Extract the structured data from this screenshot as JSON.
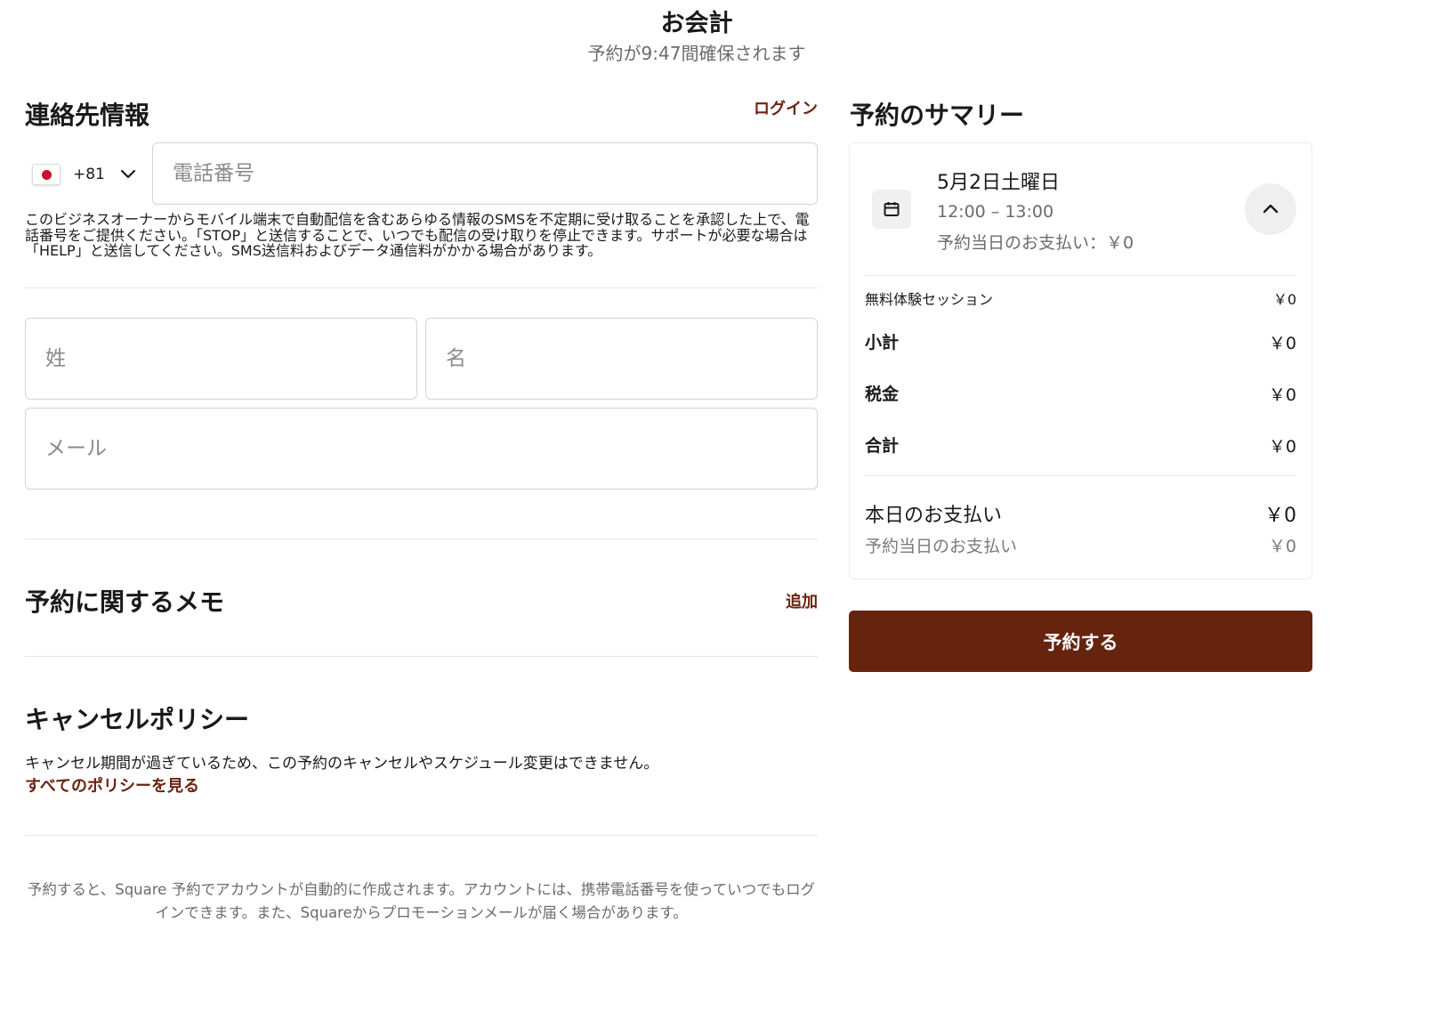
{
  "header": {
    "title": "お会計",
    "subtitle": "予約が9:47間確保されます"
  },
  "contact": {
    "title": "連絡先情報",
    "login_link": "ログイン",
    "country_code": "+81",
    "phone_placeholder": "電話番号",
    "consent_text": "このビジネスオーナーからモバイル端末で自動配信を含むあらゆる情報のSMSを不定期に受け取ることを承認した上で、電話番号をご提供ください。「STOP」と送信することで、いつでも配信の受け取りを停止できます。サポートが必要な場合は「HELP」と送信してください。SMS送信料およびデータ通信料がかかる場合があります。",
    "last_name_placeholder": "姓",
    "first_name_placeholder": "名",
    "email_placeholder": "メール"
  },
  "memo": {
    "title": "予約に関するメモ",
    "add_link": "追加"
  },
  "cancel_policy": {
    "title": "キャンセルポリシー",
    "text": "キャンセル期間が過ぎているため、この予約のキャンセルやスケジュール変更はできません。",
    "link": "すべてのポリシーを見る"
  },
  "footer_note": "予約すると、Square 予約でアカウントが自動的に作成されます。アカウントには、携帯電話番号を使っていつでもログインできます。また、Squareからプロモーションメールが届く場合があります。",
  "summary": {
    "title": "予約のサマリー",
    "date": "5月2日土曜日",
    "time": "12:00 – 13:00",
    "due_on_day": "予約当日のお支払い：￥0",
    "item_name": "無料体験セッション",
    "item_price": "￥0",
    "subtotal_label": "小計",
    "subtotal_value": "￥0",
    "tax_label": "税金",
    "tax_value": "￥0",
    "total_label": "合計",
    "total_value": "￥0",
    "today_label": "本日のお支払い",
    "today_value": "￥0",
    "on_day_label": "予約当日のお支払い",
    "on_day_value": "￥0",
    "book_button": "予約する"
  },
  "colors": {
    "accent": "#66240f",
    "link": "#6b2412"
  }
}
